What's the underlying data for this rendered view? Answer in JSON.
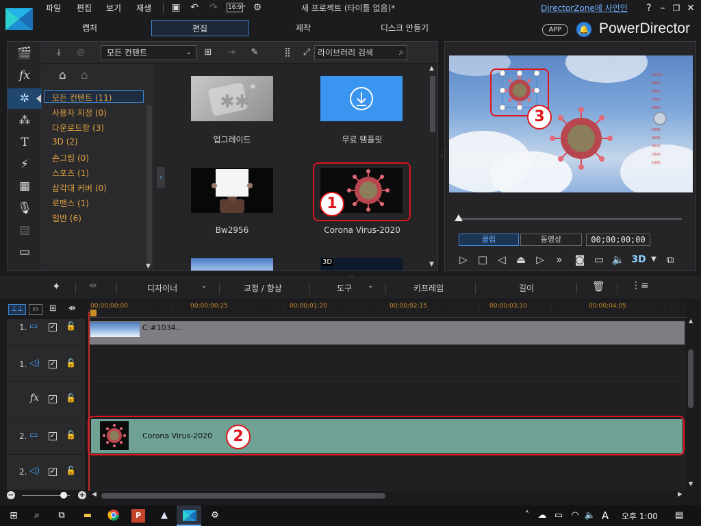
{
  "menubar": {
    "items": [
      "파일",
      "편집",
      "보기",
      "재생"
    ],
    "aspect_ratio": "16:9",
    "project_title": "새 프로젝트 (타이틀 없음)*",
    "signin_link": "DirectorZone에 사인인",
    "help": "?"
  },
  "mode_tabs": [
    "캡처",
    "편집",
    "제작",
    "디스크 만들기"
  ],
  "active_mode_tab": "편집",
  "brand": {
    "app_badge": "APP",
    "name": "PowerDirector"
  },
  "library": {
    "content_filter": "모든 컨텐트",
    "search_placeholder": "라이브러리 검색",
    "categories": [
      {
        "label": "모든 컨텐트",
        "count": "(11)"
      },
      {
        "label": "사용자 지정",
        "count": "(0)"
      },
      {
        "label": "다운로드함",
        "count": "(3)"
      },
      {
        "label": "3D",
        "count": "(2)"
      },
      {
        "label": "손그림",
        "count": "(0)"
      },
      {
        "label": "스포츠",
        "count": "(1)"
      },
      {
        "label": "삼각대 커버",
        "count": "(0)"
      },
      {
        "label": "로맨스",
        "count": "(1)"
      },
      {
        "label": "일반",
        "count": "(6)"
      }
    ],
    "selected_category": "모든 컨텐트",
    "items": [
      {
        "label": "업그레이드",
        "icon": "star-sticker-icon"
      },
      {
        "label": "무료 템플릿",
        "icon": "download-icon"
      },
      {
        "label": "Bw2956",
        "icon": "person-with-sign"
      },
      {
        "label": "Corona Virus-2020",
        "icon": "virus-image"
      }
    ],
    "partial_badge": "3D"
  },
  "preview": {
    "mode_clip": "클립",
    "mode_movie": "동영상",
    "timecode": "00;00;00;00",
    "three_d": "3D",
    "gauge_ticks": [
      "10000",
      "9000",
      "8000",
      "7000",
      "6000",
      "5000",
      "4000",
      "3000",
      "2000",
      "1000"
    ],
    "progress": 0
  },
  "edit_toolbar": {
    "designer": "디자이너",
    "correction": "교정 / 향상",
    "tools": "도구",
    "keyframe": "키프레임",
    "duration": "길이"
  },
  "timeline": {
    "ruler_ticks": [
      "00;00;00;00",
      "00;00;00;25",
      "00;00;01;20",
      "00;00;02;15",
      "00;00;03;10",
      "00;00;04;05"
    ],
    "tracks": [
      {
        "num": "1.",
        "type": "video"
      },
      {
        "num": "1.",
        "type": "audio"
      },
      {
        "num": "",
        "type": "fx",
        "icon_text": "fx"
      },
      {
        "num": "2.",
        "type": "video"
      },
      {
        "num": "2.",
        "type": "audio"
      }
    ],
    "clip_1_label": "C:#1034...",
    "clip_2_label": "Corona Virus-2020"
  },
  "annotations": [
    "1",
    "2",
    "3"
  ],
  "taskbar": {
    "clock": "오후 1:00",
    "ime": "A"
  },
  "colors": {
    "accent": "#3f89d6",
    "category_text": "#e0a23f",
    "annotation": "#e0141b",
    "clip_selected": "#6fa294",
    "ruler_text": "#c98c26"
  }
}
